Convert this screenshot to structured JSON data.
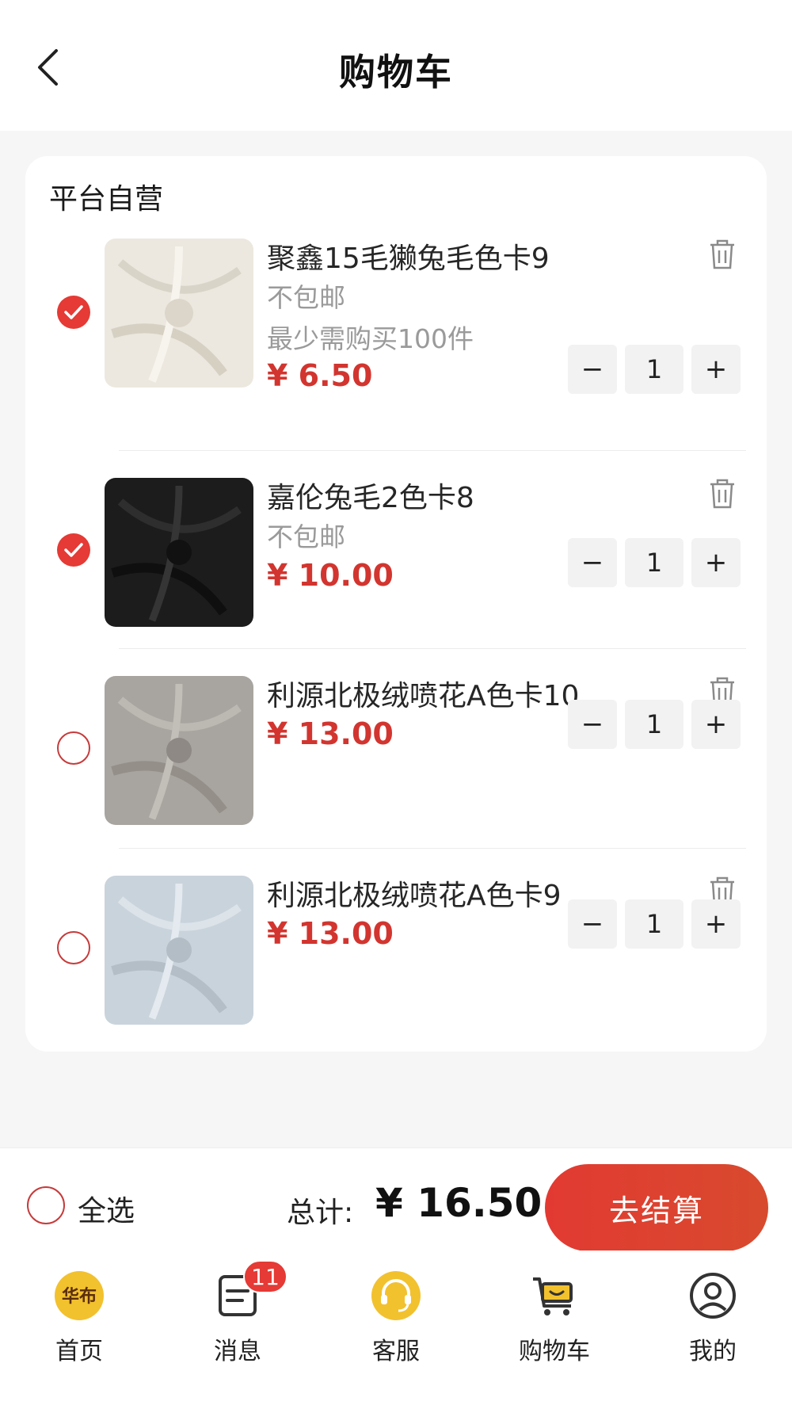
{
  "header": {
    "title": "购物车"
  },
  "store": {
    "name": "平台自营"
  },
  "items": [
    {
      "title": "聚鑫15毛獭兔毛色卡9",
      "shipping": "不包邮",
      "min_order": "最少需购买100件",
      "price": "¥ 6.50",
      "qty": "1",
      "selected": true,
      "swatch_color": "#ece8df"
    },
    {
      "title": "嘉伦兔毛2色卡8",
      "shipping": "不包邮",
      "price": "¥ 10.00",
      "qty": "1",
      "selected": true,
      "swatch_color": "#1c1c1c"
    },
    {
      "title": "利源北极绒喷花A色卡10",
      "price": "¥ 13.00",
      "qty": "1",
      "selected": false,
      "swatch_color": "#a8a49f"
    },
    {
      "title": "利源北极绒喷花A色卡9",
      "price": "¥ 13.00",
      "qty": "1",
      "selected": false,
      "swatch_color": "#c9d3db"
    }
  ],
  "qty_controls": {
    "minus": "−",
    "plus": "+"
  },
  "checkout": {
    "select_all_label": "全选",
    "total_label": "总计:",
    "total_value": "¥ 16.50",
    "button_label": "去结算"
  },
  "tabbar": {
    "tabs": [
      {
        "label": "首页",
        "icon": "home-logo-icon",
        "logo_text": "华布"
      },
      {
        "label": "消息",
        "icon": "message-icon",
        "badge": "11"
      },
      {
        "label": "客服",
        "icon": "customer-service-icon"
      },
      {
        "label": "购物车",
        "icon": "cart-icon"
      },
      {
        "label": "我的",
        "icon": "profile-icon"
      }
    ]
  },
  "colors": {
    "accent": "#e53a35",
    "price": "#d2352f",
    "tab_yellow": "#f2c12e"
  }
}
